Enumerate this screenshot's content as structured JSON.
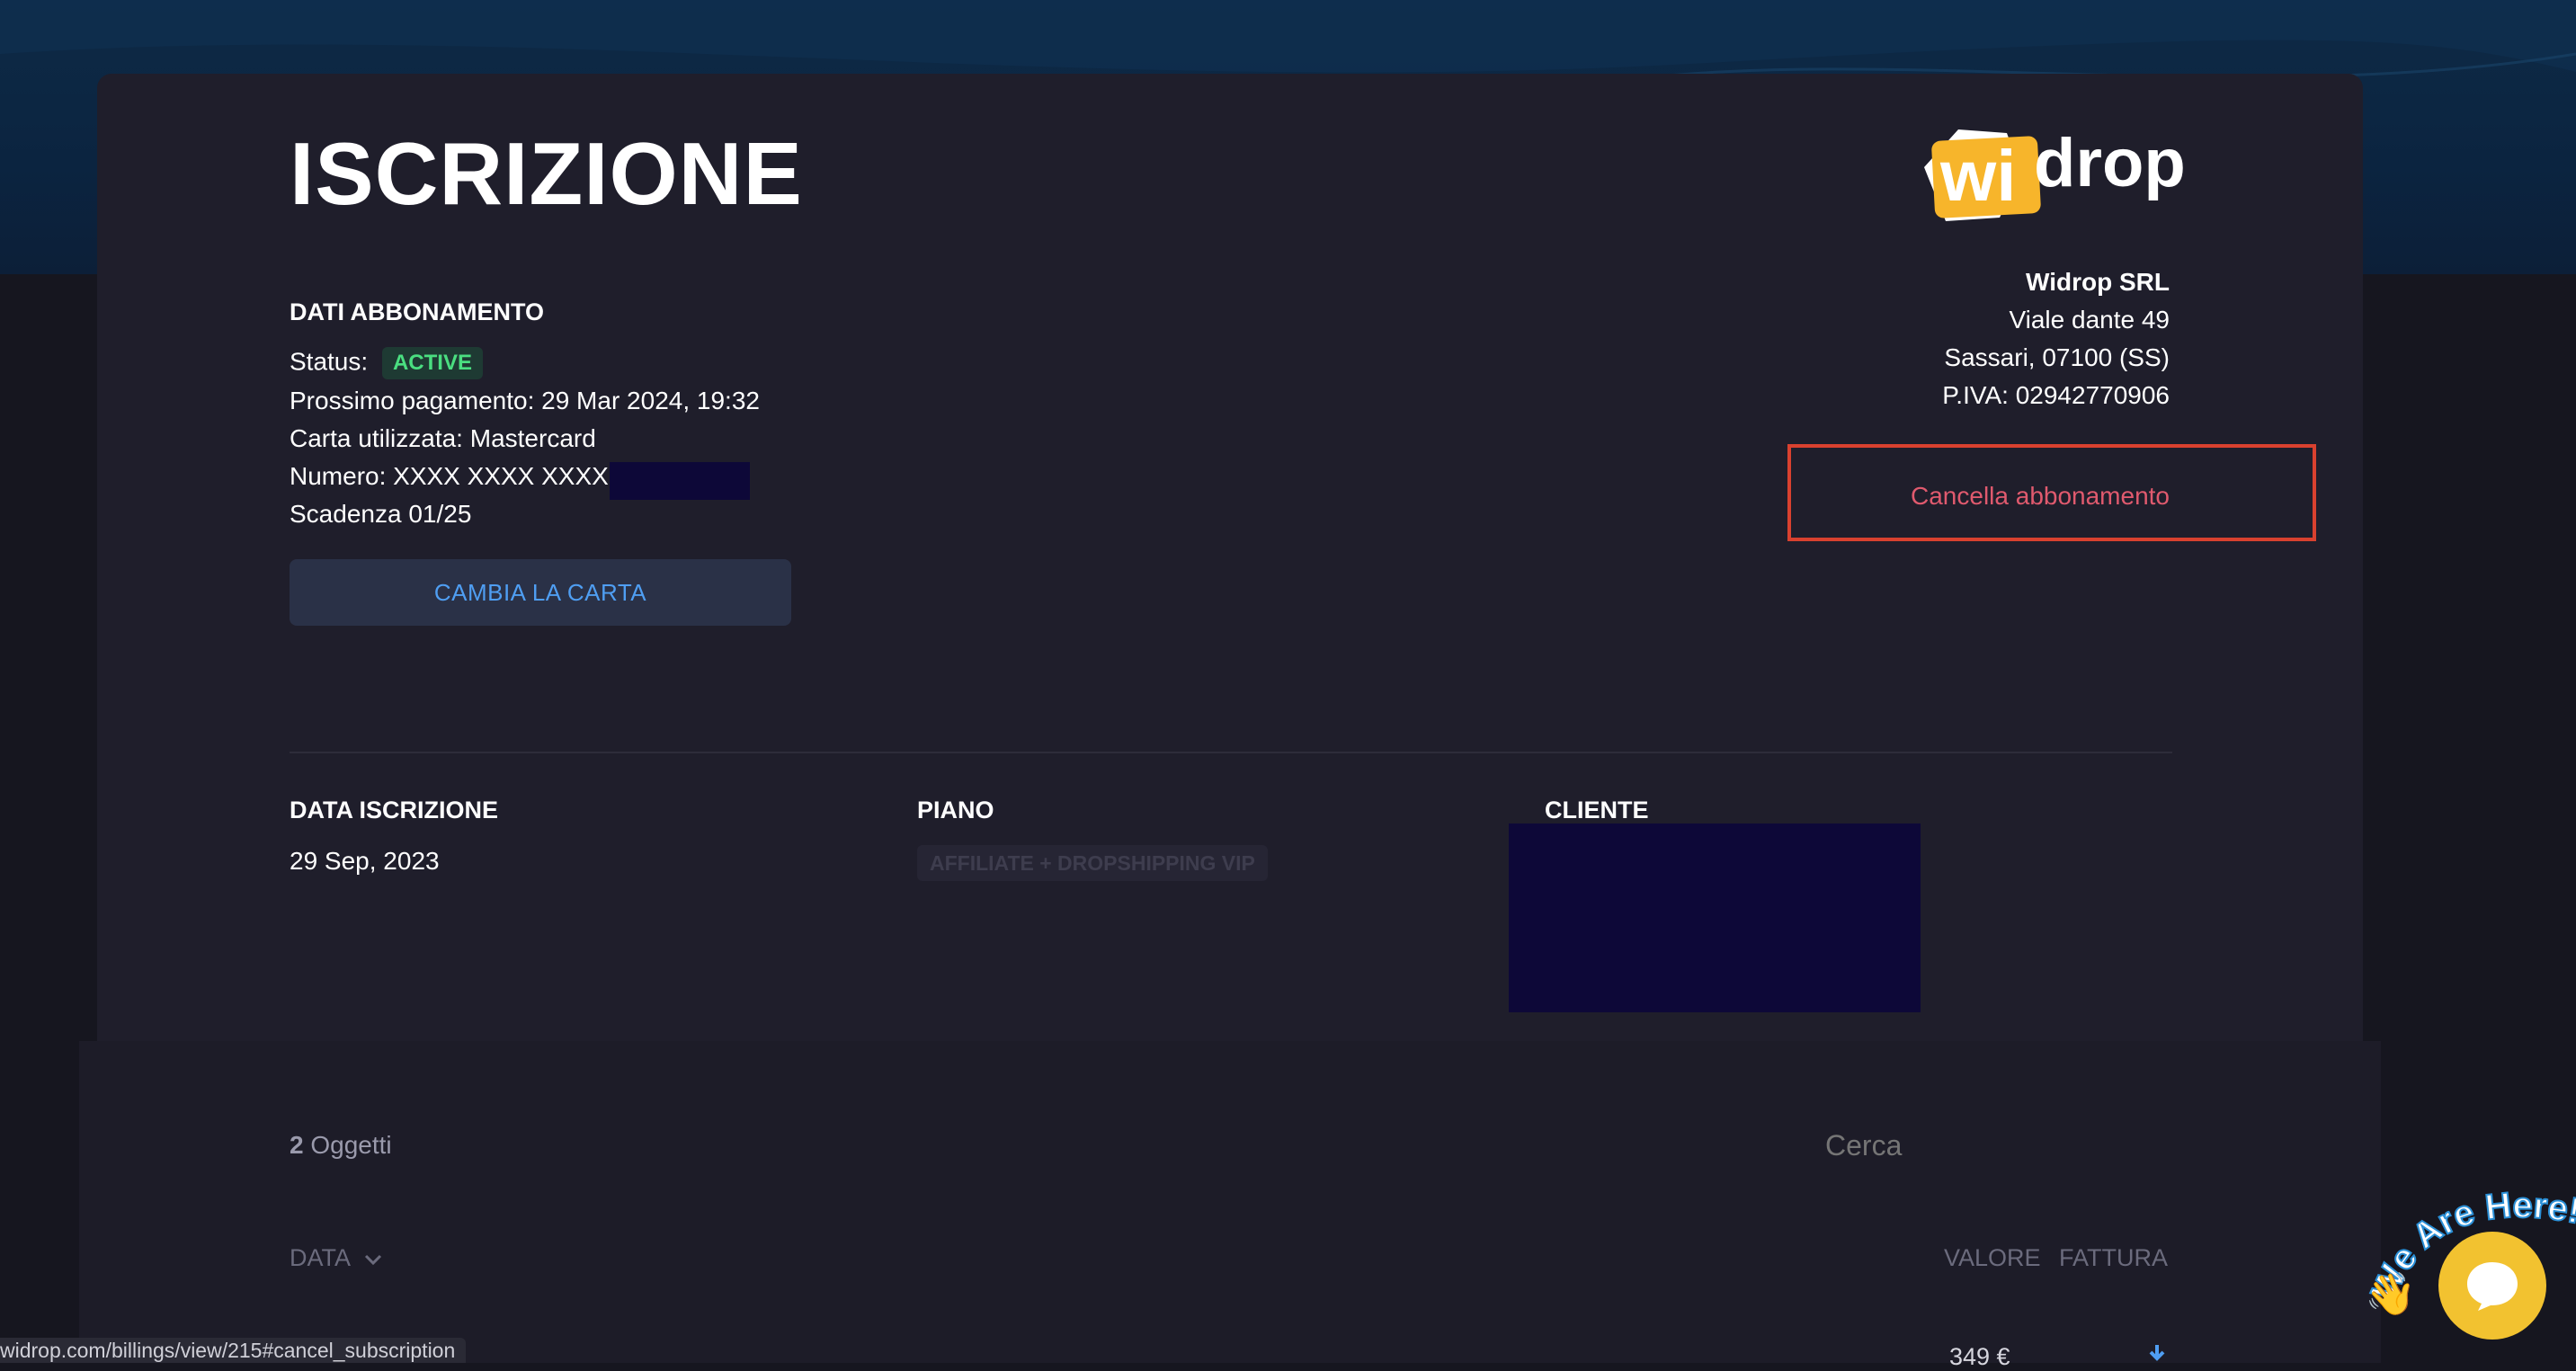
{
  "header": {
    "title": "ISCRIZIONE"
  },
  "subscription": {
    "section_label": "DATI ABBONAMENTO",
    "status_label": "Status:",
    "status_value": "ACTIVE",
    "next_payment": "Prossimo pagamento: 29 Mar 2024, 19:32",
    "card_used": "Carta utilizzata: Mastercard",
    "card_number": "Numero: XXXX XXXX XXXX",
    "expiry": "Scadenza 01/25",
    "change_card_label": "CAMBIA LA CARTA"
  },
  "company": {
    "logo_left": "wi",
    "logo_right": "drop",
    "name": "Widrop SRL",
    "address": "Viale dante 49",
    "city": "Sassari, 07100 (SS)",
    "vat": "P.IVA: 02942770906",
    "cancel_label": "Cancella abbonamento"
  },
  "details": {
    "date_label": "DATA ISCRIZIONE",
    "date_value": "29 Sep, 2023",
    "plan_label": "PIANO",
    "plan_value": "AFFILIATE + DROPSHIPPING VIP",
    "client_label": "CLIENTE"
  },
  "table": {
    "count": "2",
    "count_suffix": "Oggetti",
    "search_placeholder": "Cerca",
    "col_date": "DATA",
    "col_value": "VALORE",
    "col_invoice": "FATTURA",
    "first_row_value": "349 €"
  },
  "status_bar": {
    "url": "widrop.com/billings/view/215#cancel_subscription"
  },
  "chat": {
    "tagline": "We Are Here!",
    "wave_emoji": "👋"
  },
  "colors": {
    "accent_blue": "#4f9ef2",
    "active_green": "#4ade80",
    "cancel_red": "#e05a6e",
    "highlight_box": "#d9412f",
    "logo_yellow": "#f7b52b"
  }
}
